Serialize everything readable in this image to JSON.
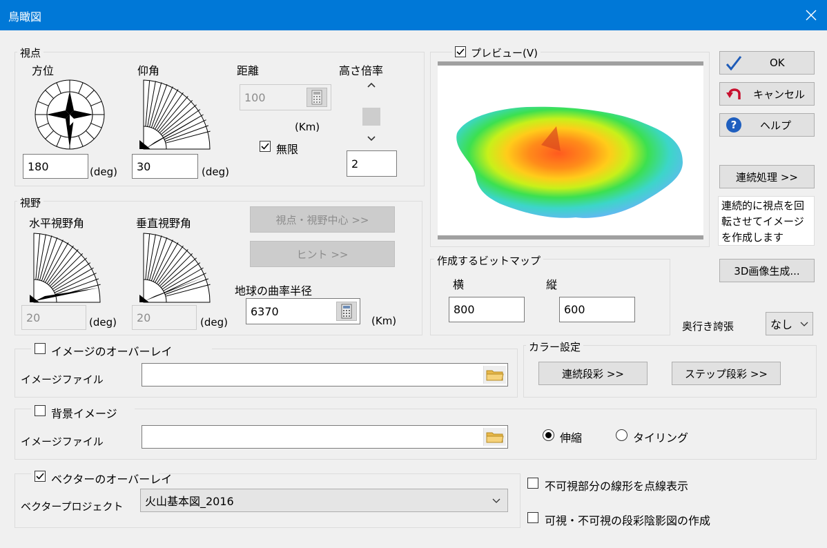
{
  "window": {
    "title": "鳥瞰図"
  },
  "viewpoint": {
    "group_label": "視点",
    "azimuth_label": "方位",
    "elevation_label": "仰角",
    "distance_label": "距離",
    "height_scale_label": "高さ倍率",
    "azimuth_value": "180",
    "elevation_value": "30",
    "distance_value": "100",
    "deg_unit": "(deg)",
    "km_unit": "(Km)",
    "infinite_label": "無限",
    "infinite_checked": true,
    "height_scale_value": "2"
  },
  "fov": {
    "group_label": "視野",
    "horizontal_label": "水平視野角",
    "vertical_label": "垂直視野角",
    "horizontal_value": "20",
    "vertical_value": "20",
    "deg_unit": "(deg)",
    "center_button": "視点・視野中心 >>",
    "hint_button": "ヒント >>",
    "earth_radius_label": "地球の曲率半径",
    "earth_radius_value": "6370",
    "km_unit": "(Km)"
  },
  "preview": {
    "label": "プレビュー(V)",
    "checked": true
  },
  "bitmap": {
    "group_label": "作成するビットマップ",
    "width_label": "横",
    "height_label": "縦",
    "width_value": "800",
    "height_value": "600"
  },
  "buttons": {
    "ok": "OK",
    "cancel": "キャンセル",
    "help": "ヘルプ",
    "continuous": "連続処理 >>",
    "continuous_desc": "連続的に視点を回転させてイメージを作成します",
    "generate3d": "3D画像生成..."
  },
  "depth": {
    "label": "奥行き誇張",
    "value": "なし"
  },
  "overlay": {
    "checkbox_label": "イメージのオーバーレイ",
    "checked": false,
    "file_label": "イメージファイル",
    "file_value": ""
  },
  "color": {
    "group_label": "カラー設定",
    "continuous_button": "連続段彩 >>",
    "step_button": "ステップ段彩 >>"
  },
  "background": {
    "checkbox_label": "背景イメージ",
    "checked": false,
    "file_label": "イメージファイル",
    "file_value": "",
    "stretch_label": "伸縮",
    "tiling_label": "タイリング",
    "selected": "stretch"
  },
  "vector": {
    "checkbox_label": "ベクターのオーバーレイ",
    "checked": true,
    "project_label": "ベクタープロジェクト",
    "project_value": "火山基本図_2016",
    "dotted_label": "不可視部分の線形を点線表示",
    "dotted_checked": false,
    "shade_label": "可視・不可視の段彩陰影図の作成",
    "shade_checked": false
  },
  "colors": {
    "titlebar": "#0078d7",
    "dialog_bg": "#f0f0f0",
    "ok_check": "#1e5bb8",
    "cancel_arrow": "#c8102e",
    "help_circle": "#1f5fbf"
  }
}
